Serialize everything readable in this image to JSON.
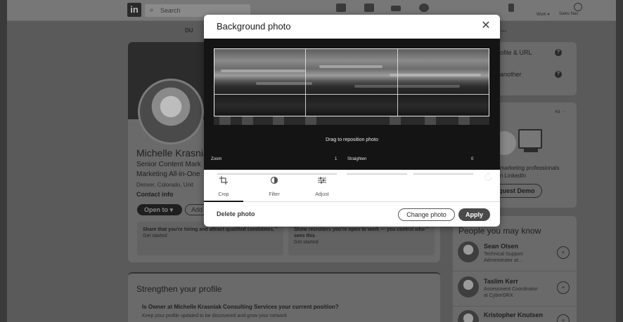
{
  "nav": {
    "logo_text": "in",
    "search_placeholder": "Search",
    "work_label": "Work ▾",
    "sales_label": "Sales Nav"
  },
  "profile": {
    "tab_fragment": "DU",
    "more_fragment": "...",
    "name": "Michelle Krasnia",
    "headline_1": "Senior Content Mark",
    "headline_2": "Marketing All-in-One",
    "location": "Denver, Colorado, Unit",
    "contact": "Contact info",
    "open_to": "Open to ▾",
    "add_section": "Add"
  },
  "hiring_cards": [
    {
      "title": "Share that you're hiring and attract qualified candidates.",
      "cta": "Get started"
    },
    {
      "title": "Show recruiters you're open to work — you control who sees this",
      "cta": "Get started"
    }
  ],
  "strengthen": {
    "title": "Strengthen your profile",
    "question": "Is Owner at Michelle Krasniak Consulting Services your current position?",
    "subtitle": "Keep your profile updated to be discovered and grow your network"
  },
  "sidebar": {
    "profile_url": "ofile & URL",
    "another": "another",
    "ad_label": "Ad ···",
    "ad_text_1": "marketing professionals",
    "ad_text_2": "n LinkedIn",
    "request_demo": "quest Demo",
    "pymk_title": "People you may know",
    "people": [
      {
        "name": "Sean Olsen",
        "line1": "Technical Support",
        "line2": "Administrator at..."
      },
      {
        "name": "Taslim Kerr",
        "line1": "Assessment Coordinator",
        "line2": "at CyberGRX"
      },
      {
        "name": "Kristopher Knutsen",
        "line1": "",
        "line2": ""
      }
    ]
  },
  "modal": {
    "title": "Background photo",
    "close_symbol": "✕",
    "drag_hint": "Drag to reposition photo",
    "zoom_label": "Zoom",
    "zoom_value": "1",
    "zoom_fraction": 0.0,
    "straighten_label": "Straighten",
    "straighten_value": "0",
    "straighten_fraction": 0.5,
    "tools": [
      {
        "label": "Crop",
        "icon": "crop-icon",
        "active": true
      },
      {
        "label": "Filter",
        "icon": "filter-icon",
        "active": false
      },
      {
        "label": "Adjust",
        "icon": "adjust-icon",
        "active": false
      }
    ],
    "delete_label": "Delete photo",
    "change_label": "Change photo",
    "apply_label": "Apply"
  }
}
